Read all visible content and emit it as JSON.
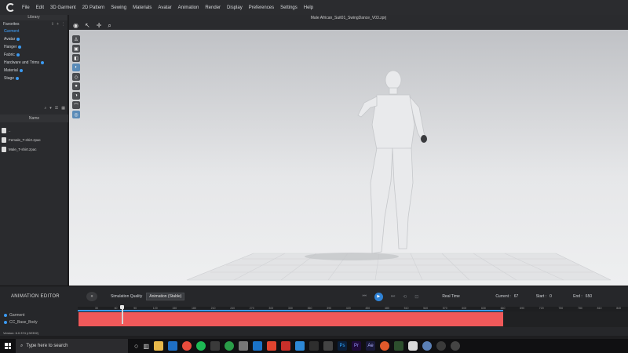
{
  "menu": {
    "items": [
      "File",
      "Edit",
      "3D Garment",
      "2D Pattern",
      "Sewing",
      "Materials",
      "Avatar",
      "Animation",
      "Render",
      "Display",
      "Preferences",
      "Settings",
      "Help"
    ]
  },
  "library": {
    "header": "Library",
    "favorites_label": "Favorites",
    "items": [
      {
        "label": "Garment",
        "selected": true
      },
      {
        "label": "Avatar"
      },
      {
        "label": "Hanger"
      },
      {
        "label": "Fabric"
      },
      {
        "label": "Hardware and Trims"
      },
      {
        "label": "Material"
      },
      {
        "label": "Stage"
      }
    ],
    "name_column": "Name",
    "files": [
      "..",
      "Female_T-shirt.zpac",
      "Male_T-shirt.zpac"
    ]
  },
  "viewport": {
    "file_title": "Male African_Suit01_SwingDance_V03.zprj"
  },
  "animation_editor": {
    "title": "ANIMATION EDITOR",
    "simulation_quality_label": "Simulation Quality",
    "simulation_quality_value": "Animation (Stable)",
    "playback_mode": "Real Time",
    "current_label": "Current :",
    "current_value": "67",
    "start_label": "Start :",
    "start_value": "0",
    "end_label": "End :",
    "end_value": "650",
    "ruler_ticks": [
      "30",
      "60",
      "90",
      "120",
      "150",
      "180",
      "210",
      "240",
      "270",
      "300",
      "330",
      "360",
      "390",
      "420",
      "450",
      "480",
      "510",
      "540",
      "570",
      "600",
      "630",
      "660",
      "690",
      "720",
      "750",
      "780",
      "810",
      "840",
      "870"
    ],
    "tracks": [
      "Garment",
      "CC_Base_Body"
    ],
    "version": "Version: 6.0.374 (r32392)"
  },
  "taskbar": {
    "search_placeholder": "Type here to search"
  }
}
